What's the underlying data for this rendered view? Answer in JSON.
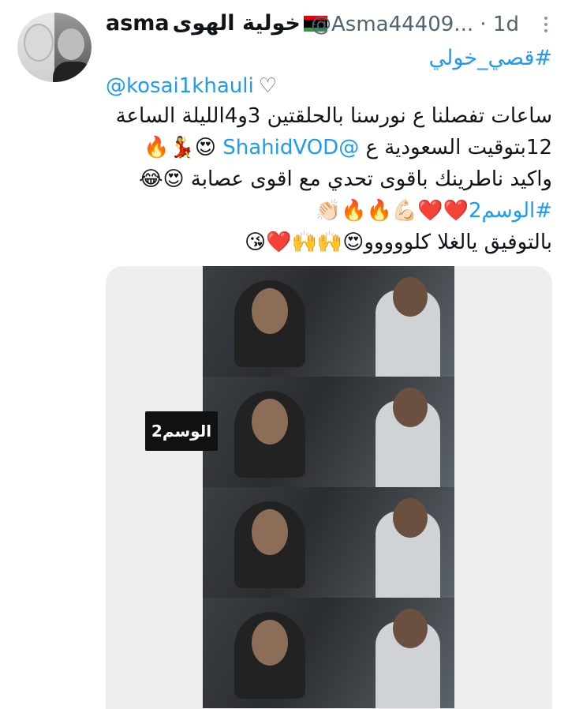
{
  "tweet": {
    "display_name": "asma",
    "display_name_ar": "خولية الهوى",
    "handle": "@Asma44409...",
    "time": "· 1d",
    "hashtag_top": "#قصي_خولي",
    "mention": "@kosai1khauli",
    "mention_heart": "♡",
    "line1": "ساعات تفصلنا ع نورسنا بالحلقتين 3و4الليلة الساعة",
    "line2_text": "12بتوقيت السعودية ع ",
    "line2_link": "@ShahidVOD",
    "line2_emoji": " 😍💃🔥",
    "line3": "واكيد ناطرينك باقوى تحدي مع اقوى عصابة 😍😂",
    "line4_hashtag": "#الوسم2",
    "line4_emoji": "❤️❤️💪🏻🔥🔥👏🏻",
    "line5": "بالتوفيق يالغلا كلووووو😍🙌🙌❤️😘"
  },
  "media": {
    "label": "الوسم2",
    "frames": [
      1,
      2,
      3,
      4
    ]
  },
  "colors": {
    "accent": "#1d9bf0",
    "muted": "#536471",
    "text": "#0f1419"
  }
}
